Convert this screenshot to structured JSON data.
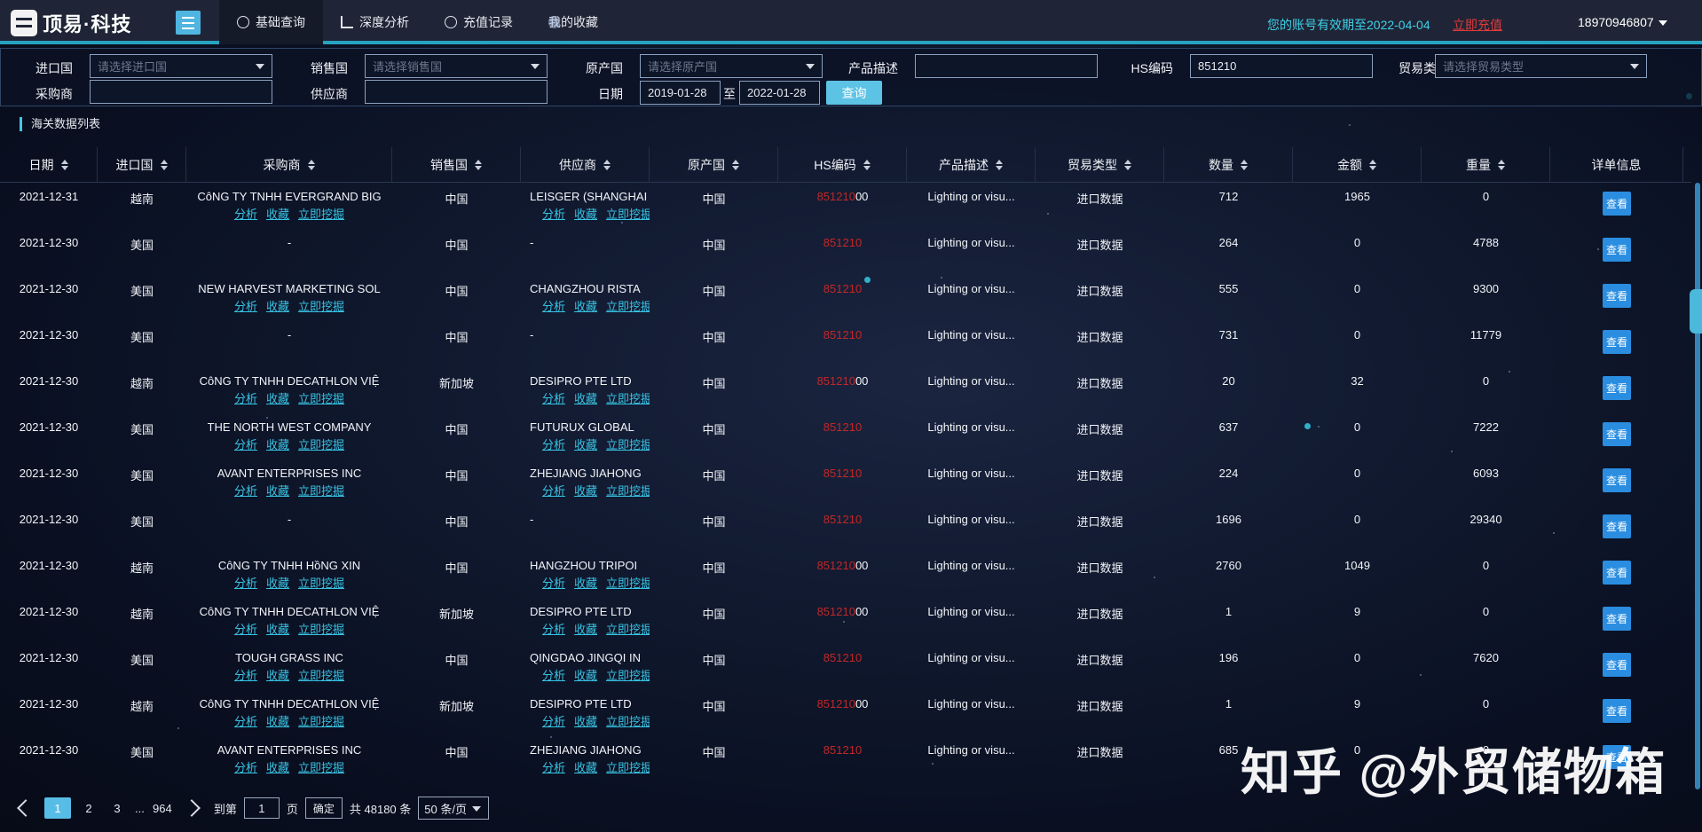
{
  "header": {
    "logo_text": "顶易·科技",
    "nav": [
      {
        "label": "基础查询",
        "active": true
      },
      {
        "label": "深度分析",
        "active": false
      },
      {
        "label": "充值记录",
        "active": false
      },
      {
        "label": "我的收藏",
        "active": false
      }
    ],
    "expire_notice": "您的账号有效期至2022-04-04",
    "recharge": "立即充值",
    "user": "18970946807"
  },
  "filters": {
    "import_country": {
      "label": "进口国",
      "placeholder": "请选择进口国"
    },
    "sales_country": {
      "label": "销售国",
      "placeholder": "请选择销售国"
    },
    "origin_country": {
      "label": "原产国",
      "placeholder": "请选择原产国"
    },
    "product_desc": {
      "label": "产品描述",
      "value": ""
    },
    "hs_code": {
      "label": "HS编码",
      "value": "851210"
    },
    "trade_type": {
      "label": "贸易类型",
      "placeholder": "请选择贸易类型"
    },
    "buyer": {
      "label": "采购商",
      "value": ""
    },
    "supplier": {
      "label": "供应商",
      "value": ""
    },
    "date": {
      "label": "日期",
      "from": "2019-01-28",
      "to_label": "至",
      "to": "2022-01-28"
    },
    "query_button": "查询"
  },
  "section_title": "海关数据列表",
  "table": {
    "columns": [
      "日期",
      "进口国",
      "采购商",
      "销售国",
      "供应商",
      "原产国",
      "HS编码",
      "产品描述",
      "贸易类型",
      "数量",
      "金额",
      "重量",
      "详单信息"
    ],
    "link_labels": [
      "分析",
      "收藏",
      "立即挖掘"
    ],
    "view_label": "查看",
    "rows": [
      {
        "date": "2021-12-31",
        "import": "越南",
        "buyer": "CôNG TY TNHH EVERGRAND BIG",
        "buyer_links": true,
        "sales": "中国",
        "supplier": "LEISGER (SHANGHAI",
        "supplier_links": true,
        "origin": "中国",
        "hs": "851210",
        "hs_suffix": "00",
        "desc": "Lighting or visu...",
        "trade": "进口数据",
        "qty": "712",
        "amount": "1965",
        "weight": "0"
      },
      {
        "date": "2021-12-30",
        "import": "美国",
        "buyer": "-",
        "buyer_links": false,
        "sales": "中国",
        "supplier": "-",
        "supplier_links": false,
        "origin": "中国",
        "hs": "851210",
        "hs_suffix": "",
        "desc": "Lighting or visu...",
        "trade": "进口数据",
        "qty": "264",
        "amount": "0",
        "weight": "4788"
      },
      {
        "date": "2021-12-30",
        "import": "美国",
        "buyer": "NEW HARVEST MARKETING SOL",
        "buyer_links": true,
        "sales": "中国",
        "supplier": "CHANGZHOU RISTA",
        "supplier_links": true,
        "origin": "中国",
        "hs": "851210",
        "hs_suffix": "",
        "desc": "Lighting or visu...",
        "trade": "进口数据",
        "qty": "555",
        "amount": "0",
        "weight": "9300"
      },
      {
        "date": "2021-12-30",
        "import": "美国",
        "buyer": "-",
        "buyer_links": false,
        "sales": "中国",
        "supplier": "-",
        "supplier_links": false,
        "origin": "中国",
        "hs": "851210",
        "hs_suffix": "",
        "desc": "Lighting or visu...",
        "trade": "进口数据",
        "qty": "731",
        "amount": "0",
        "weight": "11779"
      },
      {
        "date": "2021-12-30",
        "import": "越南",
        "buyer": "CôNG TY TNHH DECATHLON VIỆ",
        "buyer_links": true,
        "sales": "新加坡",
        "supplier": "DESIPRO PTE LTD",
        "supplier_links": true,
        "origin": "中国",
        "hs": "851210",
        "hs_suffix": "00",
        "desc": "Lighting or visu...",
        "trade": "进口数据",
        "qty": "20",
        "amount": "32",
        "weight": "0"
      },
      {
        "date": "2021-12-30",
        "import": "美国",
        "buyer": "THE NORTH WEST COMPANY",
        "buyer_links": true,
        "sales": "中国",
        "supplier": "FUTURUX GLOBAL",
        "supplier_links": true,
        "origin": "中国",
        "hs": "851210",
        "hs_suffix": "",
        "desc": "Lighting or visu...",
        "trade": "进口数据",
        "qty": "637",
        "amount": "0",
        "weight": "7222"
      },
      {
        "date": "2021-12-30",
        "import": "美国",
        "buyer": "AVANT ENTERPRISES INC",
        "buyer_links": true,
        "sales": "中国",
        "supplier": "ZHEJIANG JIAHONG",
        "supplier_links": true,
        "origin": "中国",
        "hs": "851210",
        "hs_suffix": "",
        "desc": "Lighting or visu...",
        "trade": "进口数据",
        "qty": "224",
        "amount": "0",
        "weight": "6093"
      },
      {
        "date": "2021-12-30",
        "import": "美国",
        "buyer": "-",
        "buyer_links": false,
        "sales": "中国",
        "supplier": "-",
        "supplier_links": false,
        "origin": "中国",
        "hs": "851210",
        "hs_suffix": "",
        "desc": "Lighting or visu...",
        "trade": "进口数据",
        "qty": "1696",
        "amount": "0",
        "weight": "29340"
      },
      {
        "date": "2021-12-30",
        "import": "越南",
        "buyer": "CôNG TY TNHH HồNG XIN",
        "buyer_links": true,
        "sales": "中国",
        "supplier": "HANGZHOU TRIPOI",
        "supplier_links": true,
        "origin": "中国",
        "hs": "851210",
        "hs_suffix": "00",
        "desc": "Lighting or visu...",
        "trade": "进口数据",
        "qty": "2760",
        "amount": "1049",
        "weight": "0"
      },
      {
        "date": "2021-12-30",
        "import": "越南",
        "buyer": "CôNG TY TNHH DECATHLON VIỆ",
        "buyer_links": true,
        "sales": "新加坡",
        "supplier": "DESIPRO PTE LTD",
        "supplier_links": true,
        "origin": "中国",
        "hs": "851210",
        "hs_suffix": "00",
        "desc": "Lighting or visu...",
        "trade": "进口数据",
        "qty": "1",
        "amount": "9",
        "weight": "0"
      },
      {
        "date": "2021-12-30",
        "import": "美国",
        "buyer": "TOUGH GRASS INC",
        "buyer_links": true,
        "sales": "中国",
        "supplier": "QINGDAO JINGQI IN",
        "supplier_links": true,
        "origin": "中国",
        "hs": "851210",
        "hs_suffix": "",
        "desc": "Lighting or visu...",
        "trade": "进口数据",
        "qty": "196",
        "amount": "0",
        "weight": "7620"
      },
      {
        "date": "2021-12-30",
        "import": "越南",
        "buyer": "CôNG TY TNHH DECATHLON VIỆ",
        "buyer_links": true,
        "sales": "新加坡",
        "supplier": "DESIPRO PTE LTD",
        "supplier_links": true,
        "origin": "中国",
        "hs": "851210",
        "hs_suffix": "00",
        "desc": "Lighting or visu...",
        "trade": "进口数据",
        "qty": "1",
        "amount": "9",
        "weight": "0"
      },
      {
        "date": "2021-12-30",
        "import": "美国",
        "buyer": "AVANT ENTERPRISES INC",
        "buyer_links": true,
        "sales": "中国",
        "supplier": "ZHEJIANG JIAHONG",
        "supplier_links": true,
        "origin": "中国",
        "hs": "851210",
        "hs_suffix": "",
        "desc": "Lighting or visu...",
        "trade": "进口数据",
        "qty": "685",
        "amount": "0",
        "weight": "0"
      }
    ]
  },
  "pagination": {
    "pages": [
      "1",
      "2",
      "3"
    ],
    "ellipsis": "...",
    "last_page": "964",
    "goto_label": "到第",
    "goto_value": "1",
    "page_unit": "页",
    "confirm": "确定",
    "total": "共 48180 条",
    "page_size": "50 条/页"
  },
  "watermark": "知乎 @外贸储物箱"
}
